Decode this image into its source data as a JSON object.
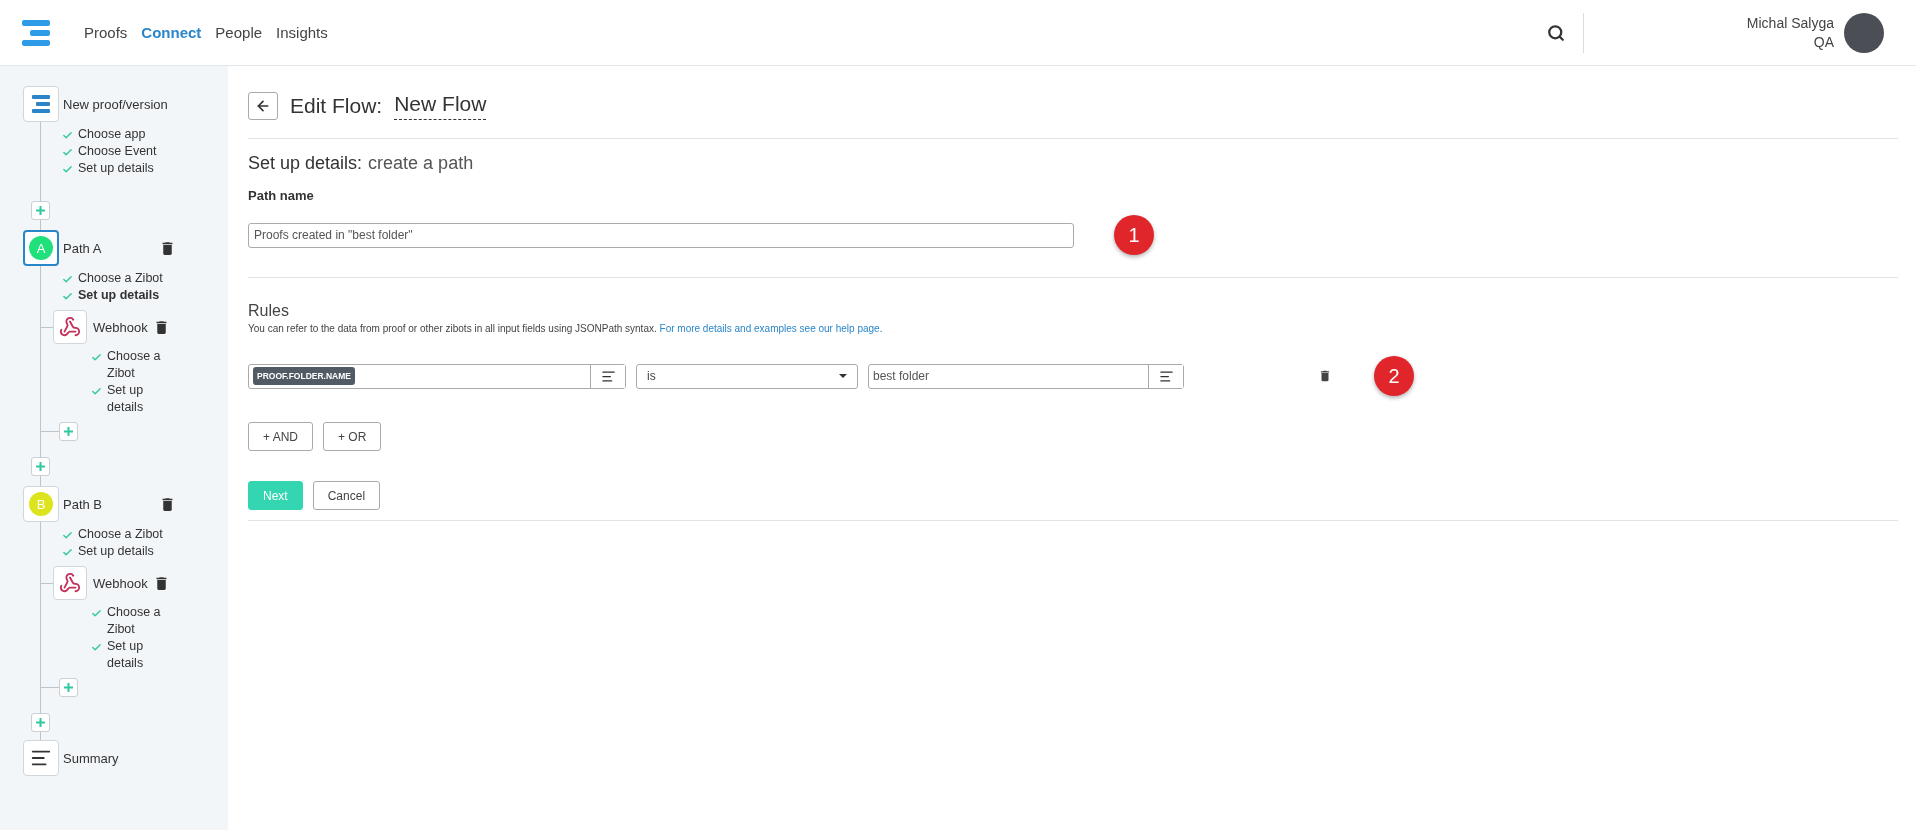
{
  "topbar": {
    "nav": [
      {
        "label": "Proofs",
        "selected": false
      },
      {
        "label": "Connect",
        "selected": true
      },
      {
        "label": "People",
        "selected": false
      },
      {
        "label": "Insights",
        "selected": false
      }
    ],
    "user": {
      "name": "Michal Salyga",
      "role": "QA"
    }
  },
  "sidebar": {
    "steps": [
      {
        "kind": "trigger",
        "title": "New proof/version",
        "selected": false,
        "checks": [
          {
            "label": "Choose app",
            "current": false
          },
          {
            "label": "Choose Event",
            "current": false
          },
          {
            "label": "Set up details",
            "current": false
          }
        ]
      },
      {
        "kind": "path",
        "badge": "A",
        "color": "#1fe07a",
        "title": "Path A",
        "selected": true,
        "checks": [
          {
            "label": "Choose a Zibot",
            "current": false
          },
          {
            "label": "Set up details",
            "current": true
          }
        ],
        "actions": [
          {
            "title": "Webhook",
            "checks": [
              {
                "label": "Choose a Zibot",
                "current": false
              },
              {
                "label": "Set up details",
                "current": false
              }
            ]
          }
        ]
      },
      {
        "kind": "path",
        "badge": "B",
        "color": "#dde31c",
        "title": "Path B",
        "selected": false,
        "checks": [
          {
            "label": "Choose a Zibot",
            "current": false
          },
          {
            "label": "Set up details",
            "current": false
          }
        ],
        "actions": [
          {
            "title": "Webhook",
            "checks": [
              {
                "label": "Choose a Zibot",
                "current": false
              },
              {
                "label": "Set up details",
                "current": false
              }
            ]
          }
        ]
      },
      {
        "kind": "summary",
        "title": "Summary",
        "selected": false
      }
    ]
  },
  "main": {
    "title": "Edit Flow:",
    "flow_name": "New Flow",
    "heading": "Set up details:",
    "heading_detail": "create a path",
    "path_name": {
      "label": "Path name",
      "value": "Proofs created in \"best folder\"",
      "marker": "1"
    },
    "rules": {
      "title": "Rules",
      "help": "You can refer to the data from proof or other zibots in all input fields using JSONPath syntax.",
      "help_link": "For more details and examples see our help page.",
      "rows": [
        {
          "token": "PROOF.FOLDER.NAME",
          "operator": "is",
          "value": "best folder",
          "marker": "2"
        }
      ],
      "add_buttons": [
        "+ AND",
        "+ OR"
      ]
    },
    "buttons": [
      {
        "label": "Next",
        "kind": "primary"
      },
      {
        "label": "Cancel",
        "kind": "secondary"
      }
    ]
  }
}
